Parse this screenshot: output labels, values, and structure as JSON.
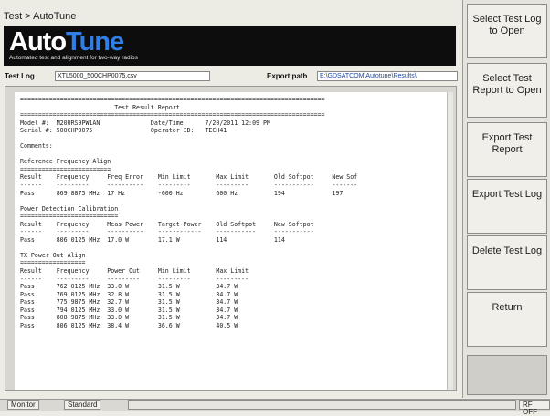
{
  "window": {
    "title": "Test > AutoTune"
  },
  "banner": {
    "logo_part1": "Auto",
    "logo_part2": "Tune",
    "tagline": "Automated test and alignment for two-way radios"
  },
  "testlog": {
    "label": "Test Log",
    "filename": "XTL5000_500CHP0075.csv",
    "export_label": "Export path",
    "export_path": "E:\\GDSATCOM\\Autotune\\Results\\"
  },
  "report": {
    "text": "====================================================================================\n                          Test Result Report\n====================================================================================\nModel #:  M20URS9PW1AN              Date/Time:     7/20/2011 12:09 PM\nSerial #: 500CHP0075                Operator ID:   TECH41\n\nComments:\n\nReference Frequency Align\n=========================\nResult    Frequency     Freq Error    Min Limit       Max Limit       Old Softpot     New Sof\n------    ---------     ----------    ---------       ---------       -----------     -------\nPass      869.8875 MHz  17 Hz         -600 Hz         600 Hz          194             197\n\nPower Detection Calibration\n===========================\nResult    Frequency     Meas Power    Target Power    Old Softpot     New Softpot\n------    ---------     ----------    ------------    -----------     -----------\nPass      806.0125 MHz  17.0 W        17.1 W          114             114\n\nTX Power Out Align\n==================\nResult    Frequency     Power Out     Min Limit       Max Limit\n------    ---------     ---------     ---------       ---------\nPass      762.0125 MHz  33.0 W        31.5 W          34.7 W\nPass      769.0125 MHz  32.8 W        31.5 W          34.7 W\nPass      775.9875 MHz  32.7 W        31.5 W          34.7 W\nPass      794.0125 MHz  33.0 W        31.5 W          34.7 W\nPass      808.9875 MHz  33.0 W        31.5 W          34.7 W\nPass      806.0125 MHz  38.4 W        36.6 W          40.5 W"
  },
  "sidebar": {
    "buttons": [
      {
        "label": "Select Test Log to Open"
      },
      {
        "label": "Select Test Report to Open"
      },
      {
        "label": "Export Test Report"
      },
      {
        "label": "Export Test Log"
      },
      {
        "label": "Delete Test Log"
      },
      {
        "label": "Return"
      }
    ]
  },
  "statusbar": {
    "tab1": "Monitor",
    "tab2": "Standard",
    "rf_status": "RF OFF"
  }
}
